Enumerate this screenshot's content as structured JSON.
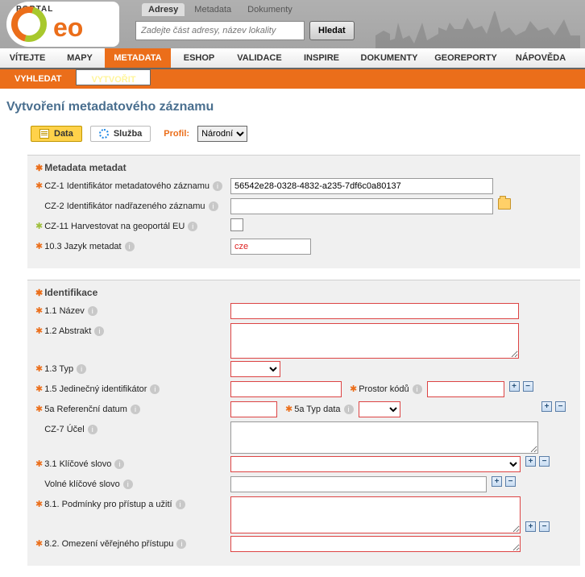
{
  "brand": {
    "portal": "PORTAL",
    "eo": "eo"
  },
  "top_tabs": [
    "Adresy",
    "Metadata",
    "Dokumenty"
  ],
  "search": {
    "placeholder": "Zadejte část adresy, název lokality",
    "btn": "Hledat"
  },
  "mainmenu": [
    "VÍTEJTE",
    "MAPY",
    "METADATA",
    "ESHOP",
    "VALIDACE",
    "INSPIRE",
    "DOKUMENTY",
    "GEOREPORTY",
    "NÁPOVĚDA"
  ],
  "submenu": {
    "a": "VYHLEDAT",
    "b": "VYTVOŘIT"
  },
  "title": "Vytvoření metadatového záznamu",
  "mode": {
    "data": "Data",
    "sluzba": "Služba"
  },
  "profil": {
    "label": "Profil:",
    "value": "Národní"
  },
  "sect1": {
    "title": "Metadata metadat",
    "r1": "CZ-1 Identifikátor metadatového záznamu",
    "r1_val": "56542e28-0328-4832-a235-7df6c0a80137",
    "r2": "CZ-2 Identifikátor nadřazeného záznamu",
    "r3": "CZ-11 Harvestovat na geoportál EU",
    "r4": "10.3 Jazyk metadat",
    "r4_val": "cze"
  },
  "sect2": {
    "title": "Identifikace",
    "r1": "1.1 Název",
    "r2": "1.2 Abstrakt",
    "r3": "1.3 Typ",
    "r4": "1.5 Jedinečný identifikátor",
    "r4b": "Prostor kódů",
    "r5": "5a Referenční datum",
    "r5b": "5a Typ data",
    "r6": "CZ-7 Účel",
    "r7": "3.1 Klíčové slovo",
    "r8": "Volné klíčové slovo",
    "r9": "8.1. Podmínky pro přístup a užití",
    "r10": "8.2. Omezení věřejného přístupu"
  }
}
